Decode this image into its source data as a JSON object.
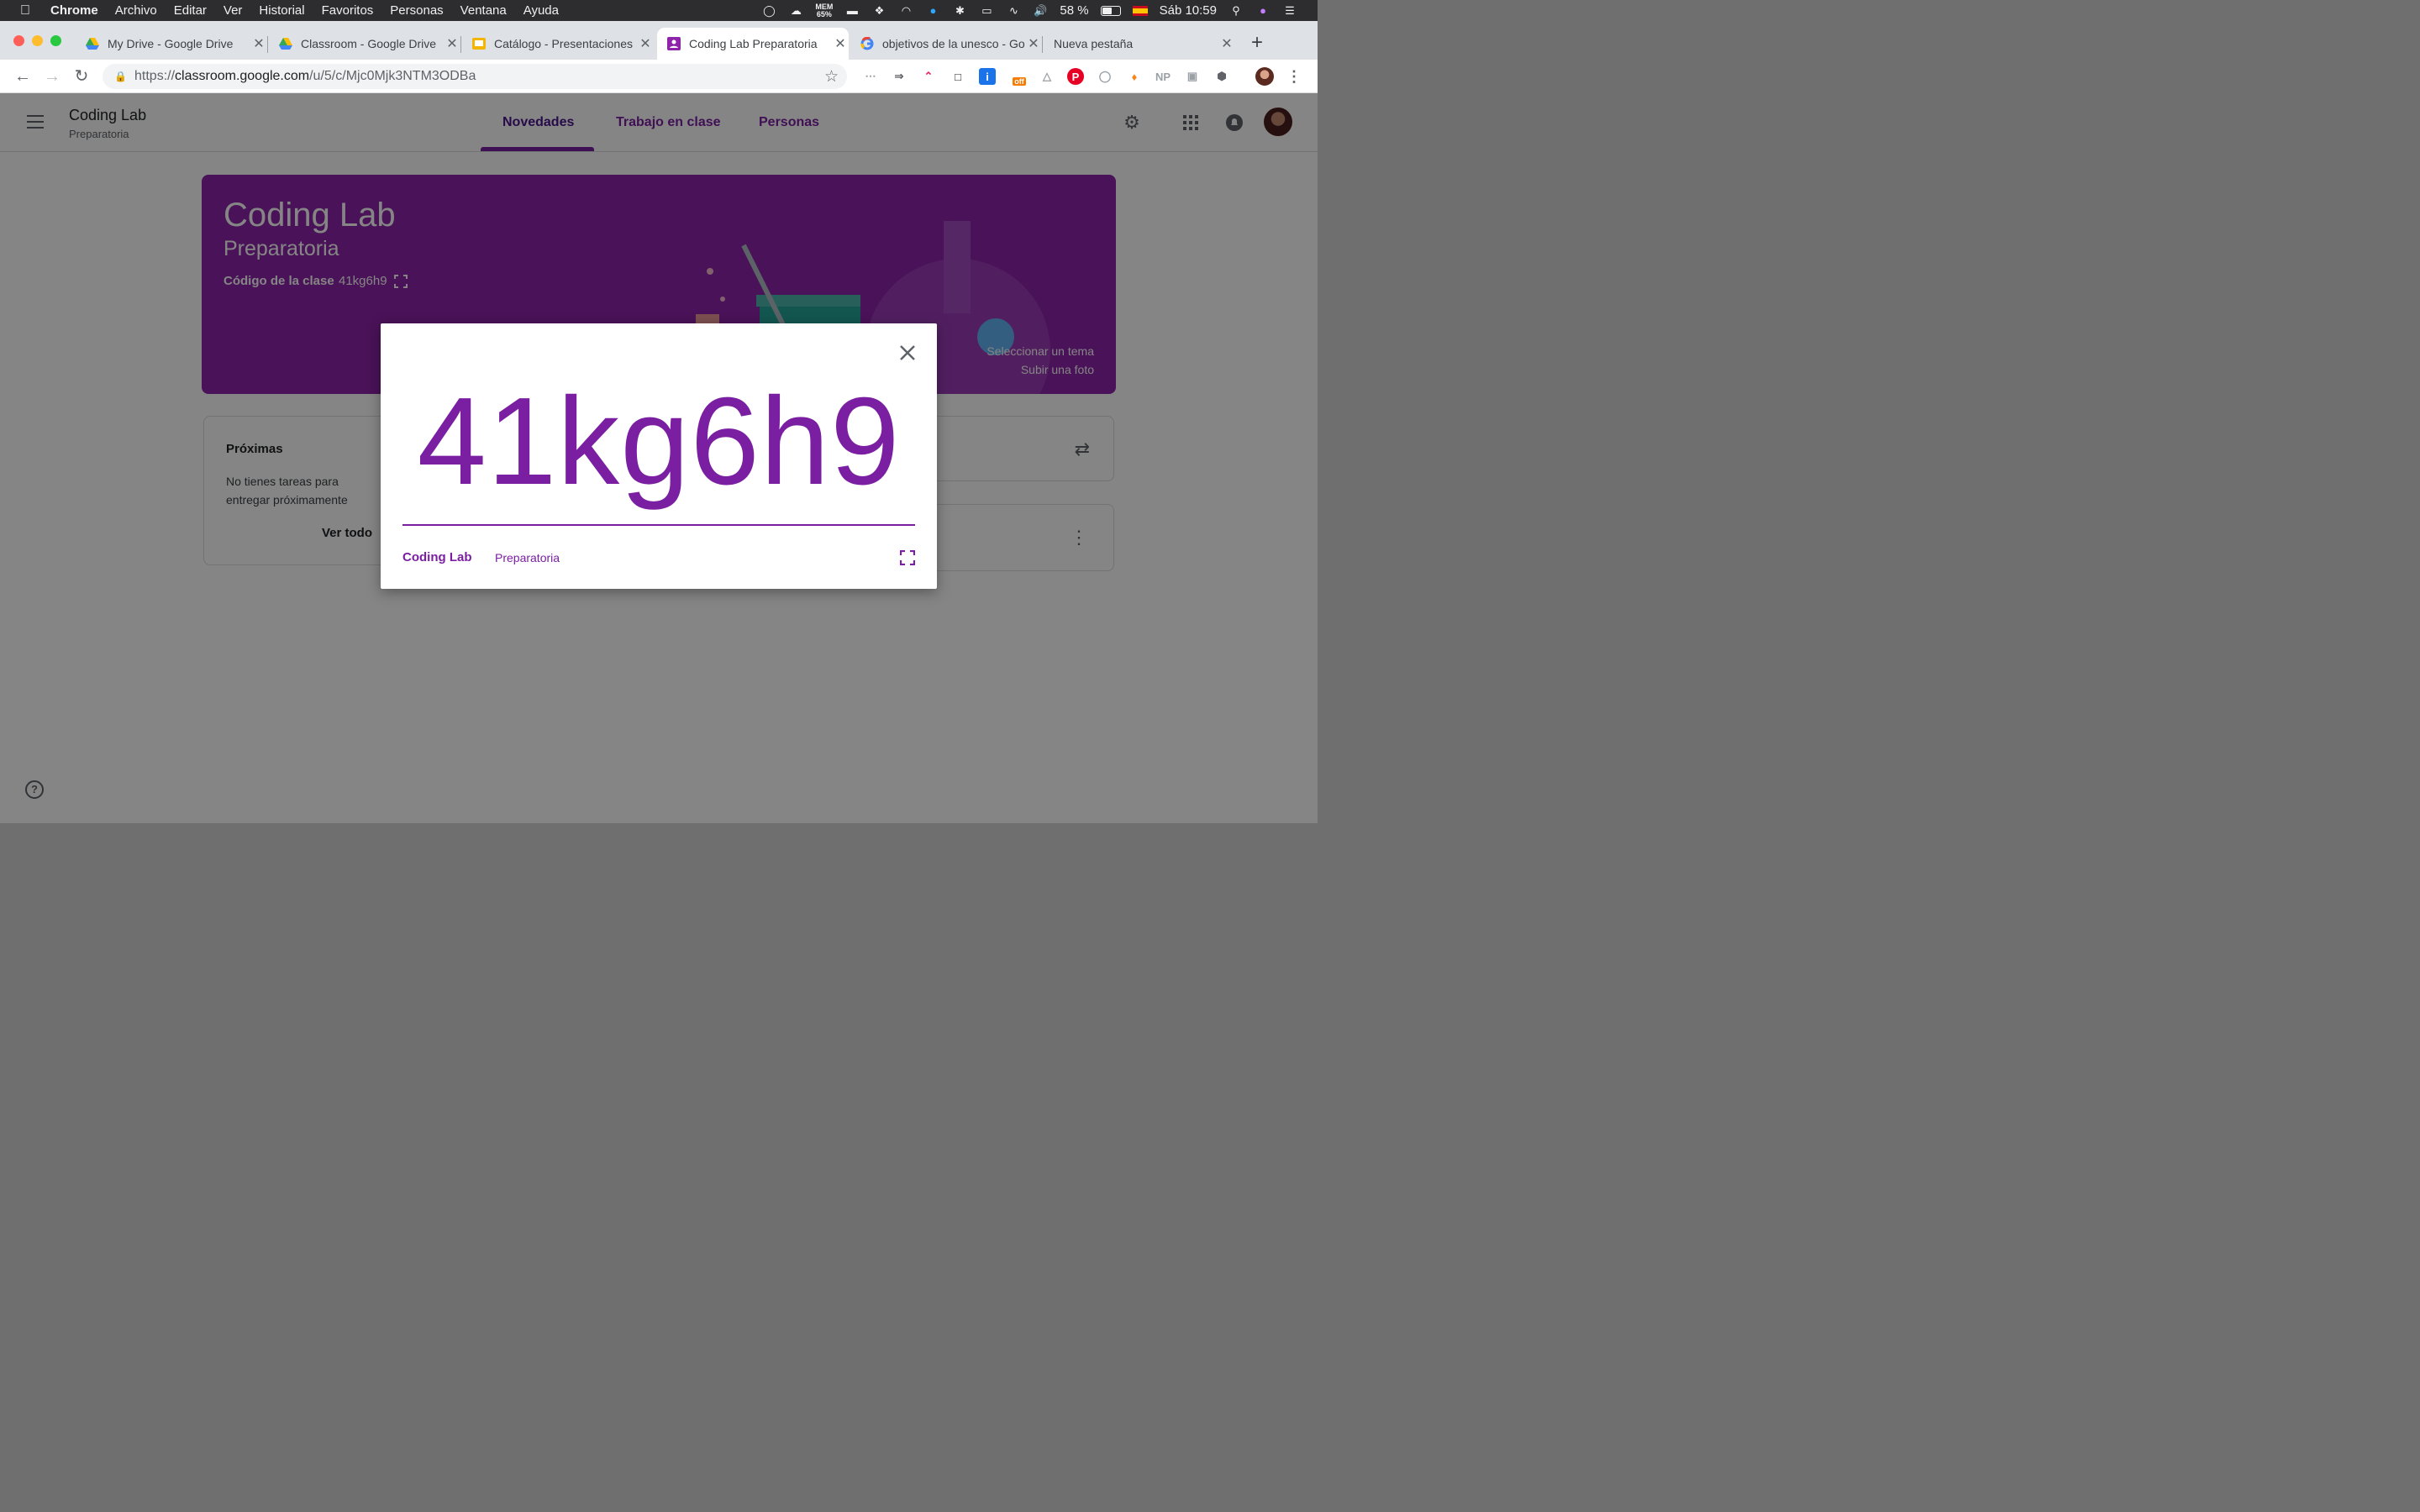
{
  "menubar": {
    "app": "Chrome",
    "items": [
      "Archivo",
      "Editar",
      "Ver",
      "Historial",
      "Favoritos",
      "Personas",
      "Ventana",
      "Ayuda"
    ],
    "mem_label": "MEM",
    "mem_value": "65%",
    "battery": "58 %",
    "battery_level": 0.58,
    "clock": "Sáb 10:59"
  },
  "browser": {
    "tabs": [
      {
        "title": "My Drive - Google Drive",
        "icon": "google-drive-icon"
      },
      {
        "title": "Classroom - Google Drive",
        "icon": "google-drive-icon"
      },
      {
        "title": "Catálogo - Presentaciones",
        "icon": "google-slides-icon"
      },
      {
        "title": "Coding Lab Preparatoria",
        "icon": "google-classroom-icon",
        "active": true
      },
      {
        "title": "objetivos de la unesco - Goo",
        "icon": "google-search-icon"
      },
      {
        "title": "Nueva pestaña",
        "icon": ""
      }
    ],
    "url_proto": "https://",
    "url_host": "classroom.google.com",
    "url_path": "/u/5/c/Mjc0Mjk3NTM3ODBa",
    "extensions": {
      "off_badge": "off",
      "np": "NP"
    }
  },
  "classroom": {
    "course_name": "Coding Lab",
    "section": "Preparatoria",
    "nav_tabs": [
      "Novedades",
      "Trabajo en clase",
      "Personas"
    ],
    "selected_tab": "Novedades",
    "banner": {
      "title": "Coding Lab",
      "subtitle": "Preparatoria",
      "code_label": "Código de la clase",
      "code_value": "41kg6h9",
      "select_theme": "Seleccionar un tema",
      "upload_photo": "Subir una foto"
    },
    "upcoming": {
      "heading": "Próximas",
      "empty_text": "No tienes tareas para entregar próximamente",
      "view_all": "Ver todo"
    },
    "help_icon": "?"
  },
  "modal": {
    "code": "41kg6h9",
    "course_name": "Coding Lab",
    "section": "Preparatoria"
  },
  "colors": {
    "primary": "#7b1fa2",
    "banner": "#8e24aa",
    "scrim": "rgba(0,0,0,0.48)"
  }
}
